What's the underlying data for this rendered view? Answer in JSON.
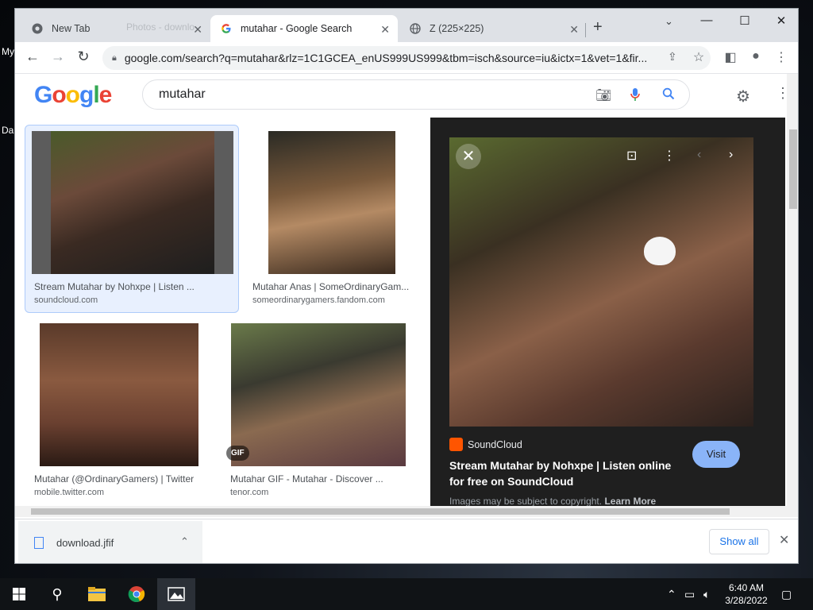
{
  "desktop": {
    "label_1": "My",
    "label_2": "Da"
  },
  "browser": {
    "tabs": [
      {
        "title": "New Tab",
        "icon": "chrome-icon"
      },
      {
        "title": "mutahar - Google Search",
        "icon": "google-g-icon"
      },
      {
        "title": "Z (225×225)",
        "icon": "globe-icon"
      }
    ],
    "ghost_tab_title": "Photos - downlo",
    "url": "google.com/search?q=mutahar&rlz=1C1GCEA_enUS999US999&tbm=isch&source=iu&ictx=1&vet=1&fir..."
  },
  "page": {
    "search_query": "mutahar",
    "results": [
      {
        "title": "Stream Mutahar by Nohxpe | Listen ...",
        "source": "soundcloud.com",
        "selected": true
      },
      {
        "title": "Mutahar Anas | SomeOrdinaryGam...",
        "source": "someordinarygamers.fandom.com"
      },
      {
        "title": "Mutahar (@OrdinaryGamers) | Twitter",
        "source": "mobile.twitter.com"
      },
      {
        "title": "Mutahar GIF - Mutahar - Discover ...",
        "source": "tenor.com",
        "badge": "GIF"
      }
    ],
    "preview": {
      "source_name": "SoundCloud",
      "title": "Stream Mutahar by Nohxpe | Listen online for free on SoundCloud",
      "visit_label": "Visit",
      "copyright_text": "Images may be subject to copyright.",
      "learn_more": "Learn More"
    }
  },
  "downloads": {
    "file_name": "download.jfif",
    "show_all_label": "Show all"
  },
  "taskbar": {
    "time": "6:40 AM",
    "date": "3/28/2022"
  },
  "colors": {
    "accent_blue": "#1a73e8",
    "selected_bg": "#e8f0fe",
    "preview_bg": "#1f1f1f",
    "visit_button": "#8ab4f8",
    "soundcloud_orange": "#ff5500"
  }
}
